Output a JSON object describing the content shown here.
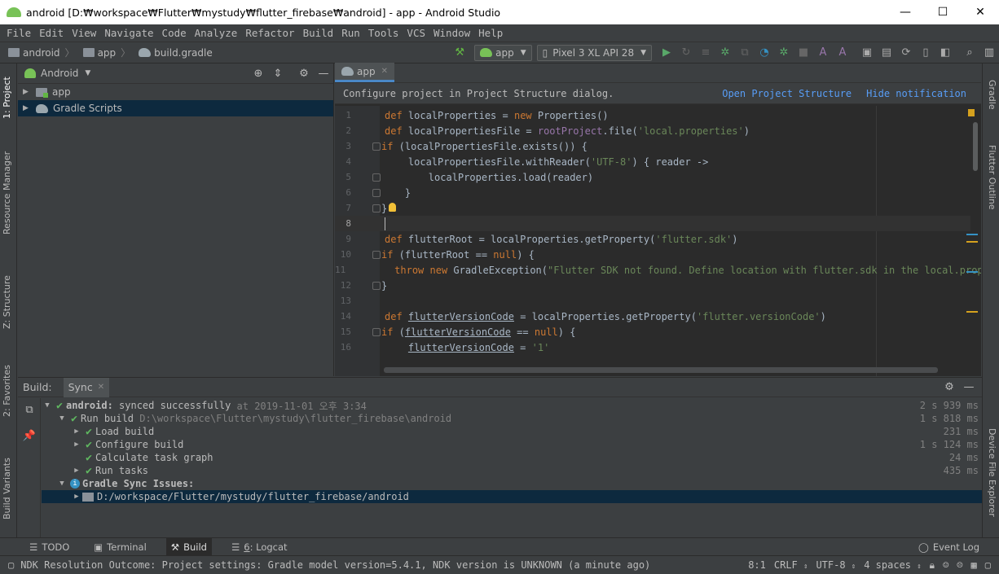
{
  "window": {
    "title": "android [D:₩workspace₩Flutter₩mystudy₩flutter_firebase₩android] - app - Android Studio",
    "minimize": "—",
    "maximize": "☐",
    "close": "✕"
  },
  "menu": [
    "File",
    "Edit",
    "View",
    "Navigate",
    "Code",
    "Analyze",
    "Refactor",
    "Build",
    "Run",
    "Tools",
    "VCS",
    "Window",
    "Help"
  ],
  "breadcrumbs": [
    "android",
    "app",
    "build.gradle"
  ],
  "toolbar": {
    "run_config": "app",
    "device": "Pixel 3 XL API 28"
  },
  "left_strip": {
    "project": "1: Project",
    "resource_manager": "Resource Manager",
    "structure": "Z: Structure",
    "favorites": "2: Favorites",
    "build_variants": "Build Variants"
  },
  "right_strip": {
    "gradle": "Gradle",
    "flutter_outline": "Flutter Outline",
    "device_file_explorer": "Device File Explorer"
  },
  "project_panel": {
    "view": "Android",
    "items": [
      "app",
      "Gradle Scripts"
    ]
  },
  "editor": {
    "tab": "app",
    "notification": "Configure project in Project Structure dialog.",
    "open_structure": "Open Project Structure",
    "hide_notification": "Hide notification",
    "line_numbers": [
      "1",
      "2",
      "3",
      "4",
      "5",
      "6",
      "7",
      "8",
      "9",
      "10",
      "11",
      "12",
      "13",
      "14",
      "15",
      "16"
    ]
  },
  "build": {
    "label": "Build:",
    "tab": "Sync",
    "rows": [
      {
        "bold": "android:",
        "text": " synced successfully",
        "dim": " at 2019-11-01 오후 3:34",
        "duration": "2 s 939 ms"
      },
      {
        "text": "Run build",
        "dim": " D:\\workspace\\Flutter\\mystudy\\flutter_firebase\\android",
        "duration": "1 s 818 ms"
      },
      {
        "text": "Load build",
        "duration": "231 ms"
      },
      {
        "text": "Configure build",
        "duration": "1 s 124 ms"
      },
      {
        "text": "Calculate task graph",
        "duration": "24 ms"
      },
      {
        "text": "Run tasks",
        "duration": "435 ms"
      },
      {
        "text": "Gradle Sync Issues:"
      },
      {
        "text": "D:/workspace/Flutter/mystudy/flutter_firebase/android"
      }
    ]
  },
  "bottom_tabs": {
    "todo": "TODO",
    "terminal": "Terminal",
    "build": "Build",
    "logcat_num": "6",
    "logcat": ": Logcat",
    "event_log": "Event Log"
  },
  "status": {
    "message": "NDK Resolution Outcome: Project settings: Gradle model version=5.4.1, NDK version is UNKNOWN (a minute ago)",
    "position": "8:1",
    "line_sep": "CRLF",
    "encoding": "UTF-8",
    "indent": "4 spaces"
  }
}
